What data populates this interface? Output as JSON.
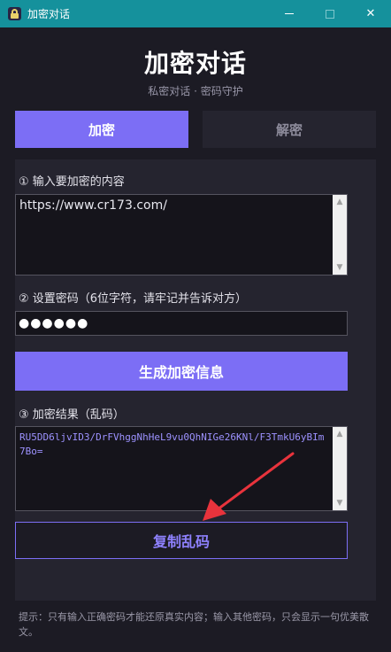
{
  "window": {
    "title": "加密对话",
    "minimize": "—",
    "close": "✕"
  },
  "header": {
    "title": "加密对话",
    "subtitle": "私密对话 · 密码守护"
  },
  "tabs": [
    {
      "label": "加密",
      "active": true
    },
    {
      "label": "解密",
      "active": false
    }
  ],
  "encrypt": {
    "step1_label": "① 输入要加密的内容",
    "input_text": "https://www.cr173.com/",
    "step2_label": "② 设置密码（6位字符，请牢记并告诉对方）",
    "password_masked": "●●●●●●",
    "generate_button": "生成加密信息",
    "step3_label": "③ 加密结果（乱码）",
    "output_text": "RU5DD6ljvID3/DrFVhggNhHeL9vu0QhNIGe26KNl/F3TmkU6yBIm7Bo=",
    "copy_button": "复制乱码"
  },
  "footer": {
    "tip": "提示：只有输入正确密码才能还原真实内容；输入其他密码，只会显示一句优美散文。"
  },
  "colors": {
    "accent": "#7c6ef5",
    "titlebar": "#15919c",
    "background": "#1c1b24",
    "panel": "#25242f",
    "annotation_arrow": "#e8333c"
  }
}
